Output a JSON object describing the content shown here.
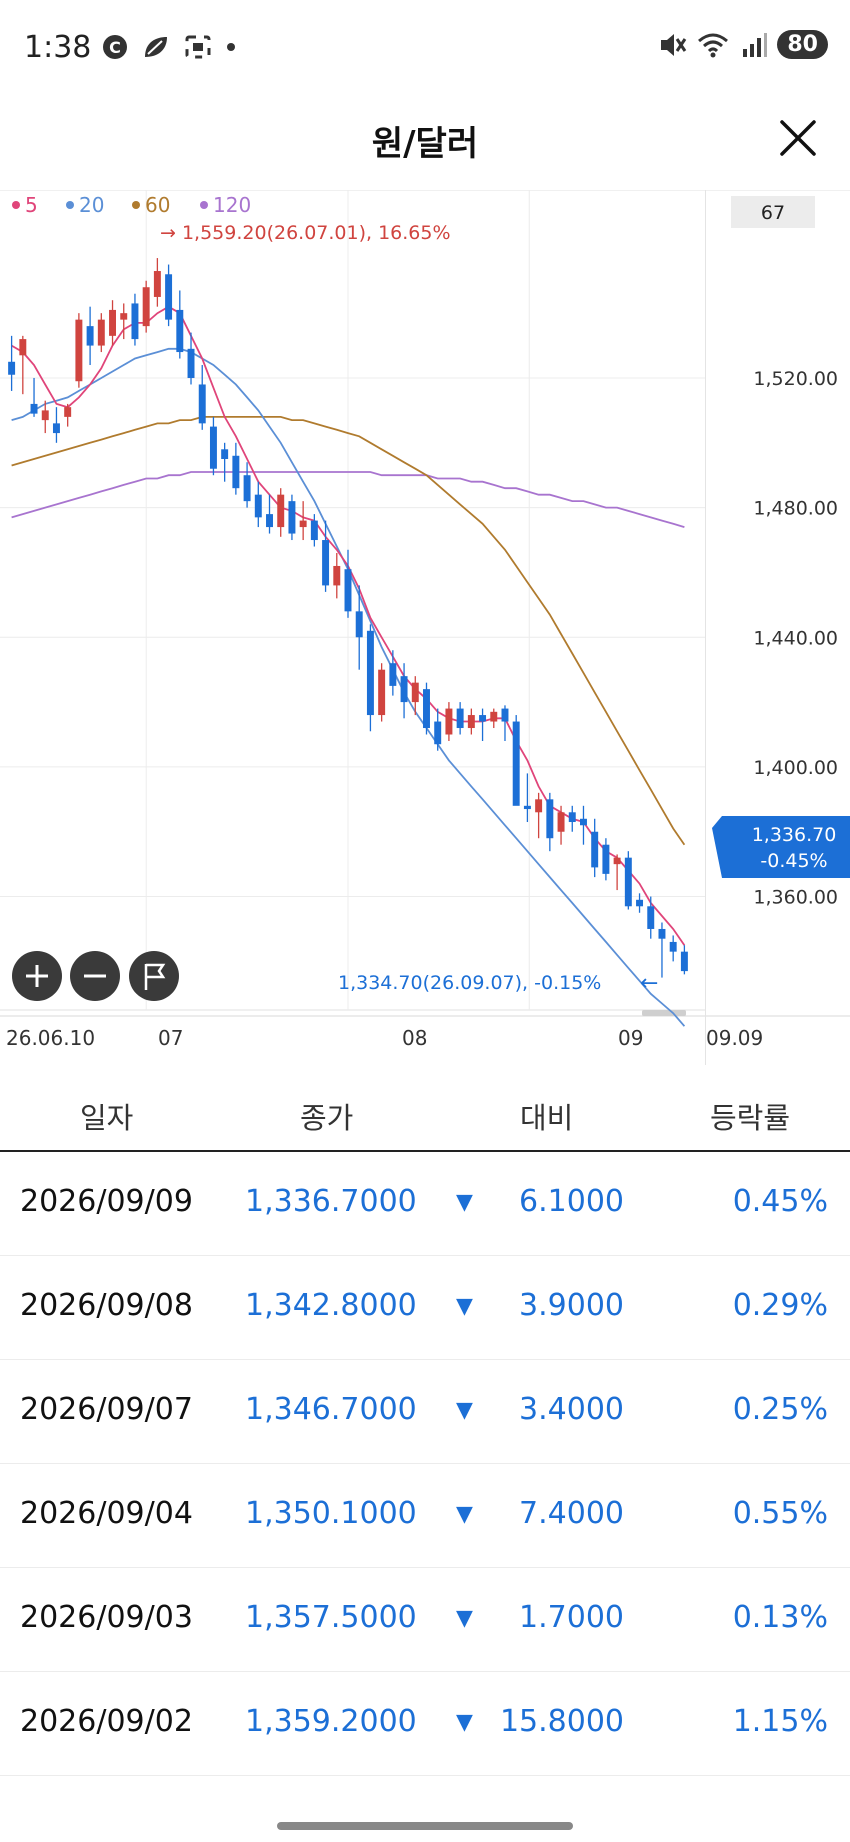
{
  "status_bar": {
    "time": "1:38",
    "battery": "80",
    "icons": [
      "c-badge-icon",
      "leaf-icon",
      "screenshot-icon",
      "dot-icon",
      "mute-icon",
      "wifi-icon",
      "signal-icon"
    ]
  },
  "header": {
    "title": "원/달러",
    "close_icon": "close-icon"
  },
  "chart": {
    "legend": [
      {
        "label": "5",
        "color": "#e0457a"
      },
      {
        "label": "20",
        "color": "#5b8fd6"
      },
      {
        "label": "60",
        "color": "#b07b2e"
      },
      {
        "label": "120",
        "color": "#a874cf"
      }
    ],
    "top_right_box": "67",
    "high_annotation": "→ 1,559.20(26.07.01), 16.65%",
    "low_annotation": "1,334.70(26.09.07), -0.15%",
    "low_arrow": "←",
    "current_price": "1,336.70",
    "current_change": "-0.45%",
    "x_labels": [
      "26.06.10",
      "07",
      "08",
      "09"
    ],
    "x_last_label": "09.09",
    "controls": [
      "zoom-in-icon",
      "zoom-out-icon",
      "flag-icon"
    ]
  },
  "chart_data": {
    "type": "candlestick",
    "y_ticks": [
      "1,520.00",
      "1,480.00",
      "1,440.00",
      "1,400.00",
      "1,360.00"
    ],
    "y_tick_values": [
      1520,
      1480,
      1440,
      1400,
      1360
    ],
    "ylim": [
      1325,
      1578
    ],
    "candles": [
      {
        "o": 1525,
        "h": 1533,
        "l": 1516,
        "c": 1521
      },
      {
        "o": 1527,
        "h": 1533,
        "l": 1515,
        "c": 1532
      },
      {
        "o": 1512,
        "h": 1520,
        "l": 1508,
        "c": 1509
      },
      {
        "o": 1507,
        "h": 1513,
        "l": 1503,
        "c": 1510
      },
      {
        "o": 1506,
        "h": 1511,
        "l": 1500,
        "c": 1503
      },
      {
        "o": 1508,
        "h": 1512,
        "l": 1505,
        "c": 1511
      },
      {
        "o": 1519,
        "h": 1540,
        "l": 1517,
        "c": 1538
      },
      {
        "o": 1536,
        "h": 1542,
        "l": 1524,
        "c": 1530
      },
      {
        "o": 1530,
        "h": 1540,
        "l": 1528,
        "c": 1538
      },
      {
        "o": 1533,
        "h": 1544,
        "l": 1530,
        "c": 1541
      },
      {
        "o": 1538,
        "h": 1543,
        "l": 1532,
        "c": 1540
      },
      {
        "o": 1543,
        "h": 1546,
        "l": 1530,
        "c": 1532
      },
      {
        "o": 1536,
        "h": 1550,
        "l": 1534,
        "c": 1548
      },
      {
        "o": 1545,
        "h": 1557,
        "l": 1542,
        "c": 1553
      },
      {
        "o": 1552,
        "h": 1555,
        "l": 1536,
        "c": 1538
      },
      {
        "o": 1541,
        "h": 1547,
        "l": 1526,
        "c": 1528
      },
      {
        "o": 1529,
        "h": 1534,
        "l": 1518,
        "c": 1520
      },
      {
        "o": 1518,
        "h": 1524,
        "l": 1504,
        "c": 1506
      },
      {
        "o": 1505,
        "h": 1508,
        "l": 1490,
        "c": 1492
      },
      {
        "o": 1498,
        "h": 1500,
        "l": 1488,
        "c": 1495
      },
      {
        "o": 1496,
        "h": 1500,
        "l": 1484,
        "c": 1486
      },
      {
        "o": 1490,
        "h": 1494,
        "l": 1480,
        "c": 1482
      },
      {
        "o": 1484,
        "h": 1488,
        "l": 1474,
        "c": 1477
      },
      {
        "o": 1478,
        "h": 1484,
        "l": 1472,
        "c": 1474
      },
      {
        "o": 1474,
        "h": 1486,
        "l": 1471,
        "c": 1484
      },
      {
        "o": 1482,
        "h": 1484,
        "l": 1470,
        "c": 1472
      },
      {
        "o": 1474,
        "h": 1482,
        "l": 1470,
        "c": 1476
      },
      {
        "o": 1476,
        "h": 1478,
        "l": 1468,
        "c": 1470
      },
      {
        "o": 1470,
        "h": 1476,
        "l": 1454,
        "c": 1456
      },
      {
        "o": 1456,
        "h": 1466,
        "l": 1452,
        "c": 1462
      },
      {
        "o": 1461,
        "h": 1467,
        "l": 1446,
        "c": 1448
      },
      {
        "o": 1448,
        "h": 1456,
        "l": 1430,
        "c": 1440
      },
      {
        "o": 1442,
        "h": 1444,
        "l": 1411,
        "c": 1416
      },
      {
        "o": 1416,
        "h": 1432,
        "l": 1414,
        "c": 1430
      },
      {
        "o": 1432,
        "h": 1436,
        "l": 1422,
        "c": 1425
      },
      {
        "o": 1428,
        "h": 1432,
        "l": 1415,
        "c": 1420
      },
      {
        "o": 1420,
        "h": 1428,
        "l": 1416,
        "c": 1426
      },
      {
        "o": 1424,
        "h": 1426,
        "l": 1410,
        "c": 1412
      },
      {
        "o": 1414,
        "h": 1418,
        "l": 1405,
        "c": 1407
      },
      {
        "o": 1410,
        "h": 1420,
        "l": 1408,
        "c": 1418
      },
      {
        "o": 1418,
        "h": 1420,
        "l": 1410,
        "c": 1412
      },
      {
        "o": 1412,
        "h": 1418,
        "l": 1410,
        "c": 1416
      },
      {
        "o": 1416,
        "h": 1418,
        "l": 1408,
        "c": 1414
      },
      {
        "o": 1414,
        "h": 1418,
        "l": 1412,
        "c": 1417
      },
      {
        "o": 1418,
        "h": 1419,
        "l": 1408,
        "c": 1414
      },
      {
        "o": 1414,
        "h": 1416,
        "l": 1396,
        "c": 1388
      },
      {
        "o": 1388,
        "h": 1398,
        "l": 1383,
        "c": 1387
      },
      {
        "o": 1386,
        "h": 1392,
        "l": 1378,
        "c": 1390
      },
      {
        "o": 1390,
        "h": 1392,
        "l": 1374,
        "c": 1378
      },
      {
        "o": 1380,
        "h": 1388,
        "l": 1376,
        "c": 1386
      },
      {
        "o": 1386,
        "h": 1388,
        "l": 1380,
        "c": 1383
      },
      {
        "o": 1384,
        "h": 1388,
        "l": 1376,
        "c": 1382
      },
      {
        "o": 1380,
        "h": 1384,
        "l": 1366,
        "c": 1369
      },
      {
        "o": 1376,
        "h": 1378,
        "l": 1365,
        "c": 1367
      },
      {
        "o": 1370,
        "h": 1373,
        "l": 1362,
        "c": 1372
      },
      {
        "o": 1372,
        "h": 1374,
        "l": 1356,
        "c": 1357
      },
      {
        "o": 1359,
        "h": 1361,
        "l": 1355,
        "c": 1357
      },
      {
        "o": 1357,
        "h": 1360,
        "l": 1347,
        "c": 1350
      },
      {
        "o": 1350,
        "h": 1352,
        "l": 1335,
        "c": 1347
      },
      {
        "o": 1346,
        "h": 1348,
        "l": 1340,
        "c": 1343
      },
      {
        "o": 1343,
        "h": 1345,
        "l": 1336,
        "c": 1337
      }
    ],
    "ma5": [
      1530,
      1528,
      1524,
      1518,
      1512,
      1511,
      1514,
      1518,
      1523,
      1530,
      1535,
      1537,
      1537,
      1540,
      1542,
      1540,
      1533,
      1526,
      1517,
      1508,
      1502,
      1495,
      1488,
      1484,
      1480,
      1479,
      1477,
      1476,
      1471,
      1467,
      1462,
      1455,
      1446,
      1440,
      1434,
      1428,
      1424,
      1421,
      1417,
      1415,
      1414,
      1414,
      1414,
      1415,
      1415,
      1408,
      1402,
      1394,
      1388,
      1386,
      1384,
      1383,
      1378,
      1374,
      1372,
      1368,
      1364,
      1358,
      1354,
      1350,
      1345
    ],
    "ma20": [
      1507,
      1508,
      1510,
      1512,
      1513,
      1514,
      1516,
      1518,
      1520,
      1522,
      1524,
      1526,
      1527,
      1528,
      1529,
      1529,
      1528,
      1526,
      1524,
      1521,
      1518,
      1514,
      1510,
      1505,
      1500,
      1494,
      1488,
      1482,
      1475,
      1468,
      1461,
      1453,
      1445,
      1437,
      1430,
      1423,
      1417,
      1412,
      1407,
      1402,
      1398,
      1394,
      1390,
      1386,
      1382,
      1378,
      1374,
      1370,
      1366,
      1362,
      1358,
      1354,
      1350,
      1346,
      1342,
      1338,
      1334,
      1330,
      1327,
      1324,
      1320
    ],
    "ma60": [
      1493,
      1494,
      1495,
      1496,
      1497,
      1498,
      1499,
      1500,
      1501,
      1502,
      1503,
      1504,
      1505,
      1506,
      1506,
      1507,
      1507,
      1508,
      1508,
      1508,
      1508,
      1508,
      1508,
      1508,
      1508,
      1507,
      1507,
      1506,
      1505,
      1504,
      1503,
      1502,
      1500,
      1498,
      1496,
      1494,
      1492,
      1490,
      1487,
      1484,
      1481,
      1478,
      1475,
      1471,
      1467,
      1462,
      1457,
      1452,
      1447,
      1441,
      1435,
      1429,
      1423,
      1417,
      1411,
      1405,
      1399,
      1393,
      1387,
      1381,
      1376
    ],
    "ma120": [
      1477,
      1478,
      1479,
      1480,
      1481,
      1482,
      1483,
      1484,
      1485,
      1486,
      1487,
      1488,
      1489,
      1489,
      1490,
      1490,
      1491,
      1491,
      1491,
      1491,
      1491,
      1491,
      1491,
      1491,
      1491,
      1491,
      1491,
      1491,
      1491,
      1491,
      1491,
      1491,
      1491,
      1490,
      1490,
      1490,
      1490,
      1490,
      1489,
      1489,
      1489,
      1488,
      1488,
      1487,
      1486,
      1486,
      1485,
      1484,
      1484,
      1483,
      1482,
      1482,
      1481,
      1480,
      1480,
      1479,
      1478,
      1477,
      1476,
      1475,
      1474
    ]
  },
  "table": {
    "headers": [
      "일자",
      "종가",
      "대비",
      "등락률"
    ],
    "rows": [
      {
        "date": "2026/09/09",
        "close": "1,336.7000",
        "diff": "6.1000",
        "rate": "0.45%"
      },
      {
        "date": "2026/09/08",
        "close": "1,342.8000",
        "diff": "3.9000",
        "rate": "0.29%"
      },
      {
        "date": "2026/09/07",
        "close": "1,346.7000",
        "diff": "3.4000",
        "rate": "0.25%"
      },
      {
        "date": "2026/09/04",
        "close": "1,350.1000",
        "diff": "7.4000",
        "rate": "0.55%"
      },
      {
        "date": "2026/09/03",
        "close": "1,357.5000",
        "diff": "1.7000",
        "rate": "0.13%"
      },
      {
        "date": "2026/09/02",
        "close": "1,359.2000",
        "diff": "15.8000",
        "rate": "1.15%"
      }
    ],
    "down_arrow": "▼"
  }
}
